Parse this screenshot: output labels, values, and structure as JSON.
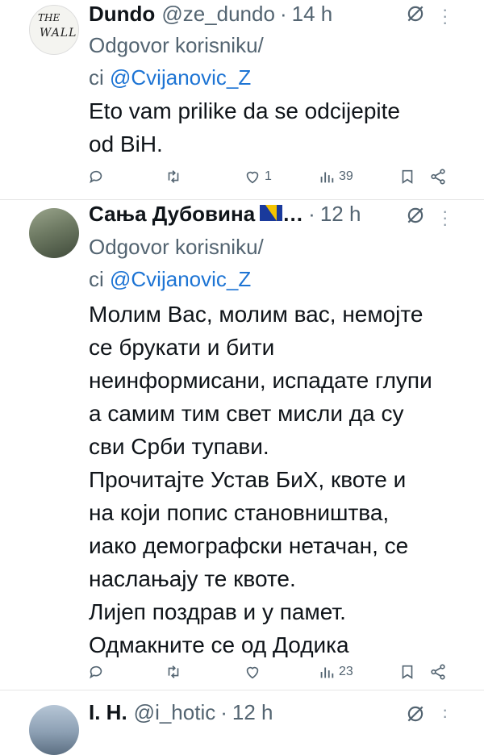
{
  "tweets": [
    {
      "name": "Dundo",
      "handle": "@ze_dundo",
      "dot": "·",
      "time": "14 h",
      "reply_prefix": "Odgovor korisniku/",
      "reply_ci": "ci",
      "mention": "@Cvijanovic_Z",
      "body": [
        "Eto vam prilike da se odcijepite",
        "od BiH."
      ],
      "likes": "1",
      "views": "39",
      "avatar_text": [
        "THE",
        "WALL"
      ]
    },
    {
      "name": "Сања Дубовина",
      "name_suffix": "…",
      "handle": "",
      "dot": "·",
      "time": "12 h",
      "reply_prefix": "Odgovor korisniku/",
      "reply_ci": "ci",
      "mention": "@Cvijanovic_Z",
      "body": [
        "Молим Вас, молим вас, немојте",
        "се брукати и бити",
        "неинформисани, испадате глупи",
        "а самим тим свет мисли да су",
        "сви Срби тупави.",
        "Прочитајте Устав БиХ, квоте и",
        "на који попис становништва,",
        "иако демографски нетачан, се",
        "наслањају те квоте.",
        "Лијеп поздрав и у памет.",
        "Одмакните се од Додика"
      ],
      "likes": "",
      "views": "23"
    },
    {
      "name": "I. H.",
      "handle": "@i_hotic",
      "dot": "·",
      "time": "12 h"
    }
  ],
  "colors": {
    "mention": "#1d74d4",
    "muted": "#536471",
    "flag_blue": "#1a3a9c",
    "flag_yellow": "#f5c400"
  },
  "icons": [
    "reply-icon",
    "retweet-icon",
    "like-icon",
    "views-icon",
    "bookmark-icon",
    "share-icon",
    "grok-icon",
    "more-icon"
  ]
}
